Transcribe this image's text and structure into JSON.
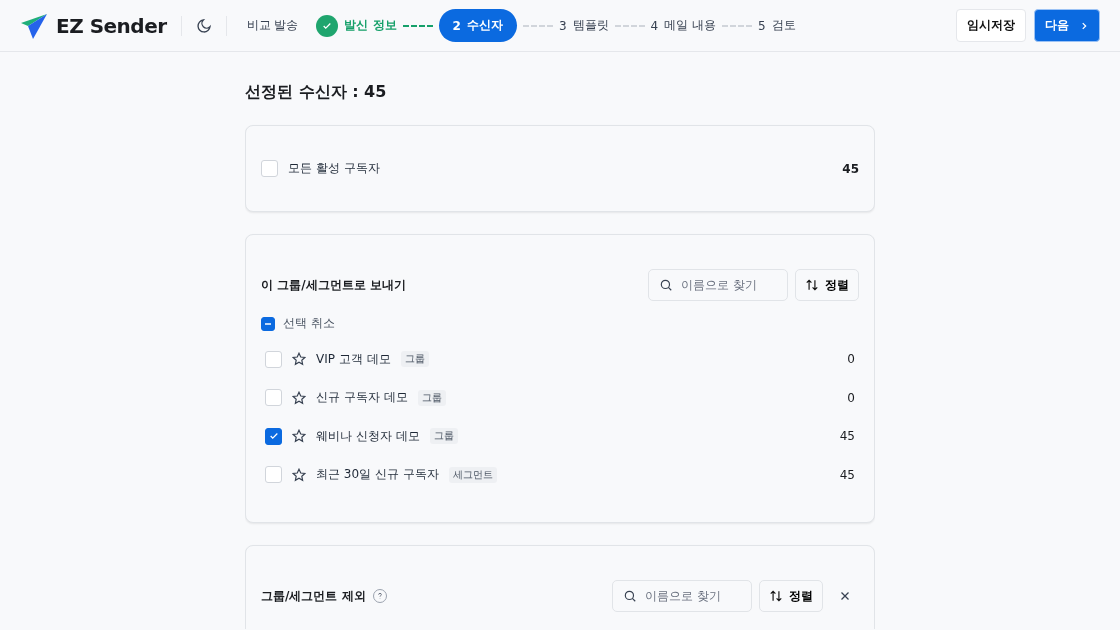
{
  "header": {
    "brand": "EZ Sender",
    "compare_link": "비교 발송",
    "steps": [
      {
        "label": "발신 정보",
        "completed": true,
        "selected": false
      },
      {
        "number": "2",
        "label": "수신자",
        "completed": false,
        "selected": true
      },
      {
        "number": "3",
        "label": "템플릿",
        "completed": false,
        "selected": false
      },
      {
        "number": "4",
        "label": "메일 내용",
        "completed": false,
        "selected": false
      },
      {
        "number": "5",
        "label": "검토",
        "completed": false,
        "selected": false
      }
    ],
    "save_button": "임시저장",
    "next_button": "다음"
  },
  "title": "선정된 수신자 : 45",
  "all_subscribers": {
    "label": "모든 활성 구독자",
    "checked": false,
    "count": "45"
  },
  "include": {
    "title": "이 그룹/세그먼트로 보내기",
    "search": {
      "placeholder": "이름으로 찾기"
    },
    "sort_button": "정렬",
    "deselect": "선택 취소",
    "partially_selected": true,
    "items": [
      {
        "name": "VIP 고객 데모",
        "tag": "그룹",
        "count": "0",
        "checked": false
      },
      {
        "name": "신규 구독자 데모",
        "tag": "그룹",
        "count": "0",
        "checked": false
      },
      {
        "name": "웨비나 신청자 데모",
        "tag": "그룹",
        "count": "45",
        "checked": true
      },
      {
        "name": "최근 30일 신규 구독자",
        "tag": "세그먼트",
        "count": "45",
        "checked": false
      }
    ]
  },
  "exclude": {
    "title": "그룹/세그먼트 제외",
    "search": {
      "placeholder": "이름으로 찾기"
    },
    "sort_button": "정렬"
  }
}
